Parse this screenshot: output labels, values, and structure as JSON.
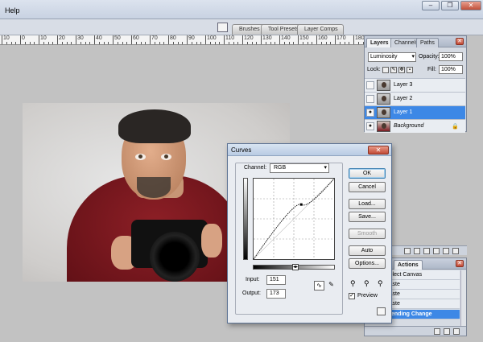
{
  "menu": {
    "help": "Help"
  },
  "well_tabs": [
    "Brushes",
    "Tool Presets",
    "Layer Comps"
  ],
  "ruler_labels": [
    "10",
    "0",
    "10",
    "20",
    "30",
    "40",
    "50",
    "60",
    "70",
    "80",
    "90",
    "100",
    "110",
    "120",
    "130",
    "140",
    "150",
    "160",
    "170",
    "180"
  ],
  "layers_panel": {
    "tabs": [
      "Layers",
      "Channels",
      "Paths"
    ],
    "blend_mode": "Luminosity",
    "opacity_label": "Opacity:",
    "opacity_value": "100%",
    "lock_label": "Lock:",
    "fill_label": "Fill:",
    "fill_value": "100%",
    "layers": [
      {
        "name": "Layer 3",
        "visible": false,
        "selected": false
      },
      {
        "name": "Layer 2",
        "visible": false,
        "selected": false
      },
      {
        "name": "Layer 1",
        "visible": true,
        "selected": true
      },
      {
        "name": "Background",
        "visible": true,
        "selected": false,
        "locked": true
      }
    ]
  },
  "history_panel": {
    "tabs": [
      "Actions"
    ],
    "items": [
      {
        "label": "Select Canvas",
        "selected": false
      },
      {
        "label": "Paste",
        "selected": false
      },
      {
        "label": "Paste",
        "selected": false
      },
      {
        "label": "Paste",
        "selected": false
      },
      {
        "label": "Blending Change",
        "selected": true
      }
    ]
  },
  "curves": {
    "title": "Curves",
    "channel_label": "Channel:",
    "channel_value": "RGB",
    "input_label": "Input:",
    "input_value": "151",
    "output_label": "Output:",
    "output_value": "173",
    "buttons": {
      "ok": "OK",
      "cancel": "Cancel",
      "load": "Load...",
      "save": "Save...",
      "smooth": "Smooth",
      "auto": "Auto",
      "options": "Options..."
    },
    "preview_label": "Preview",
    "preview_checked": true,
    "curve_points": [
      [
        0,
        0
      ],
      [
        151,
        173
      ],
      [
        255,
        255
      ]
    ]
  },
  "colors": {
    "selection": "#3d88e6",
    "jacket": "#8d1f26",
    "workspace": "#c2c2c2"
  }
}
